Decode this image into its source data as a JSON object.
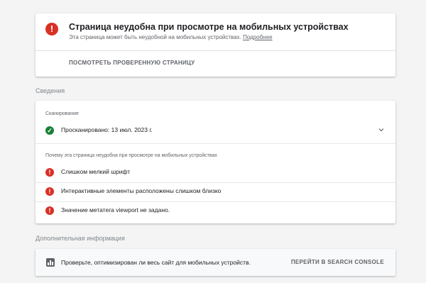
{
  "status": {
    "title": "Страница неудобна при просмотре на мобильных устройствах",
    "subtitle": "Эта страница может быть неудобной на мобильных устройствах.",
    "more_link": "Подробнее",
    "view_button": "ПОСМОТРЕТЬ ПРОВЕРЕННУЮ СТРАНИЦУ",
    "icon": "error-icon",
    "color": "#d93025"
  },
  "details": {
    "section_label": "Сведения",
    "crawl_label": "Сканирование",
    "crawl_status": "Просканировано: 13 июл. 2023 г.",
    "reasons_label": "Почему эта страница неудобна при просмотре на мобильных устройствах",
    "issues": [
      {
        "text": "Слишком мелкий шрифт"
      },
      {
        "text": "Интерактивные элементы расположены слишком близко"
      },
      {
        "text": "Значение метатега viewport не задано."
      }
    ],
    "ok_color": "#188038"
  },
  "extra": {
    "section_label": "Дополнительная информация",
    "text": "Проверьте, оптимизирован ли весь сайт для мобильных устройств.",
    "button": "ПЕРЕЙТИ В SEARCH CONSOLE",
    "icon": "bar-chart-icon"
  }
}
